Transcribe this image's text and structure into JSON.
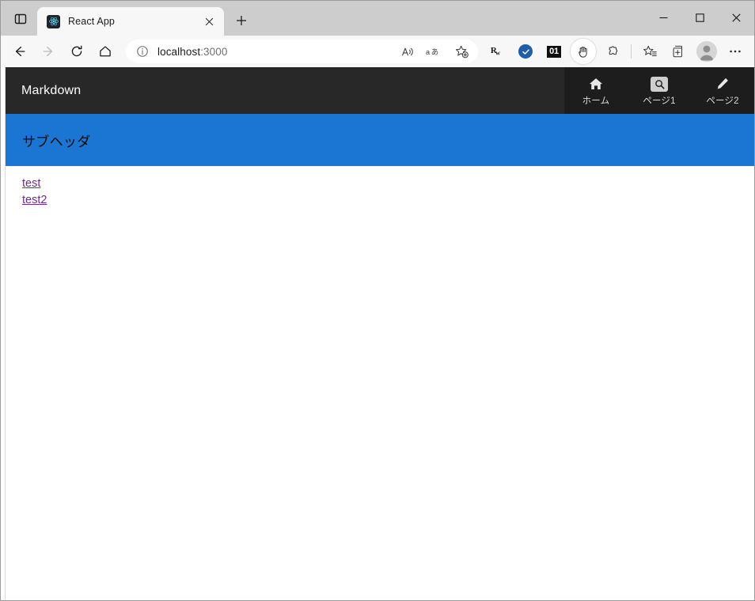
{
  "browser": {
    "vertical_tabs_tooltip": "Tab actions menu",
    "tabs": [
      {
        "title": "React App",
        "favicon": "react-logo",
        "active": true,
        "close_label": "Close tab"
      }
    ],
    "new_tab_label": "New tab",
    "window_controls": {
      "minimize": "Minimize",
      "maximize": "Maximize",
      "close": "Close"
    },
    "navigation": {
      "back": "Back",
      "forward": "Forward",
      "refresh": "Refresh",
      "home": "Home"
    },
    "address_bar": {
      "site_info_icon": "info-icon",
      "url_host": "localhost",
      "url_port": ":3000",
      "read_aloud": "Read aloud",
      "translate": "Translate this page",
      "add_favorite": "Add this page to favorites"
    },
    "extensions": [
      {
        "name": "rw-extension-icon",
        "label": "Rw"
      },
      {
        "name": "verified-extension-icon",
        "label": ""
      },
      {
        "name": "numbered-extension-icon",
        "label": "01"
      },
      {
        "name": "hand-extension-icon",
        "label": ""
      },
      {
        "name": "puzzle-icon",
        "label": "Extensions"
      }
    ],
    "toolbar_right": {
      "favorites": "Favorites",
      "collections": "Collections",
      "profile": "Profile",
      "settings_more": "Settings and more"
    }
  },
  "app": {
    "header": {
      "title": "Markdown",
      "nav": [
        {
          "icon": "home-icon",
          "label": "ホーム"
        },
        {
          "icon": "search-icon",
          "label": "ページ1"
        },
        {
          "icon": "pencil-icon",
          "label": "ページ2"
        }
      ]
    },
    "subheader": {
      "text": "サブヘッダ"
    },
    "links": [
      {
        "text": "test"
      },
      {
        "text": "test2"
      }
    ]
  },
  "colors": {
    "app_header_bg": "#282828",
    "app_nav_bg": "#1d1d1d",
    "subheader_bg": "#1a76d2",
    "link": "#6b2d8e",
    "accent_blue": "#1f5fa8"
  }
}
